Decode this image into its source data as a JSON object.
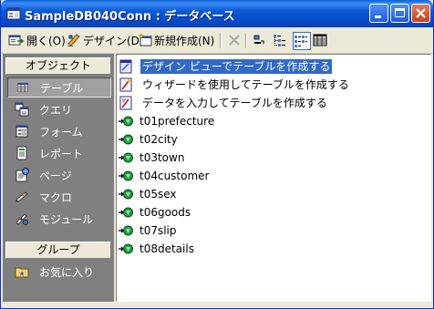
{
  "window": {
    "title": "SampleDB040Conn : データベース",
    "icon": "database-window-icon"
  },
  "toolbar": {
    "open_label": "開く(O)",
    "design_label": "デザイン(D)",
    "new_label": "新規作成(N)"
  },
  "sidebar": {
    "objects_header": "オブジェクト",
    "items": [
      {
        "label": "テーブル",
        "icon": "table-icon",
        "selected": true
      },
      {
        "label": "クエリ",
        "icon": "query-icon"
      },
      {
        "label": "フォーム",
        "icon": "form-icon"
      },
      {
        "label": "レポート",
        "icon": "report-icon"
      },
      {
        "label": "ページ",
        "icon": "page-icon"
      },
      {
        "label": "マクロ",
        "icon": "macro-icon"
      },
      {
        "label": "モジュール",
        "icon": "module-icon"
      }
    ],
    "groups_header": "グループ",
    "favorites_label": "お気に入り"
  },
  "list": {
    "shortcuts": [
      {
        "label": "デザイン ビューでテーブルを作成する",
        "selected": true
      },
      {
        "label": "ウィザードを使用してテーブルを作成する"
      },
      {
        "label": "データを入力してテーブルを作成する"
      }
    ],
    "tables": [
      "t01prefecture",
      "t02city",
      "t03town",
      "t04customer",
      "t05sex",
      "t06goods",
      "t07slip",
      "t08details"
    ]
  },
  "colors": {
    "title_bar": "#0a5ad6",
    "selection": "#316ac5",
    "sidebar_bg": "#808080",
    "linked_table_icon": "#1f9f3f"
  }
}
